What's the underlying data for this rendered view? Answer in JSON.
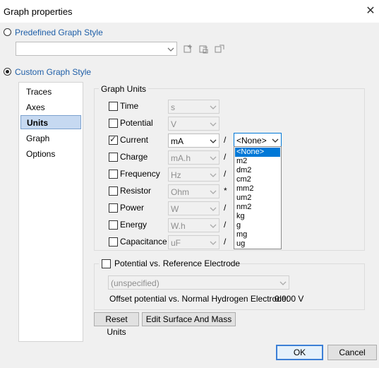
{
  "window": {
    "title": "Graph properties",
    "close_glyph": "✕"
  },
  "predefined": {
    "label": "Predefined Graph Style",
    "selected": false,
    "value": ""
  },
  "custom": {
    "label": "Custom Graph Style",
    "selected": true
  },
  "nav": {
    "items": [
      "Traces",
      "Axes",
      "Units",
      "Graph",
      "Options"
    ],
    "selected": "Units"
  },
  "units": {
    "group_label": "Graph Units",
    "rows": [
      {
        "label": "Time",
        "checked": false,
        "value": "s",
        "sep": ""
      },
      {
        "label": "Potential",
        "checked": false,
        "value": "V",
        "sep": ""
      },
      {
        "label": "Current",
        "checked": true,
        "value": "mA",
        "sep": "/"
      },
      {
        "label": "Charge",
        "checked": false,
        "value": "mA.h",
        "sep": "/"
      },
      {
        "label": "Frequency",
        "checked": false,
        "value": "Hz",
        "sep": "/"
      },
      {
        "label": "Resistor",
        "checked": false,
        "value": "Ohm",
        "sep": "*"
      },
      {
        "label": "Power",
        "checked": false,
        "value": "W",
        "sep": "/"
      },
      {
        "label": "Energy",
        "checked": false,
        "value": "W.h",
        "sep": "/"
      },
      {
        "label": "Capacitance",
        "checked": false,
        "value": "uF",
        "sep": "/"
      }
    ],
    "area_value": "<None>",
    "area_options": [
      "<None>",
      "m2",
      "dm2",
      "cm2",
      "mm2",
      "um2",
      "nm2",
      "kg",
      "g",
      "mg",
      "ug"
    ],
    "area_selected": "<None>"
  },
  "reference": {
    "label": "Potential vs. Reference Electrode",
    "checked": false,
    "value": "(unspecified)",
    "offset_label": "Offset potential vs. Normal Hydrogen Electrode:",
    "offset_value": "0.000 V"
  },
  "buttons": {
    "reset": "Reset Units",
    "edit_surface": "Edit Surface And Mass",
    "ok": "OK",
    "cancel": "Cancel"
  },
  "colors": {
    "accent": "#1f5fa8",
    "selection": "#0078d7",
    "nav_selected": "#c6d9f1"
  }
}
